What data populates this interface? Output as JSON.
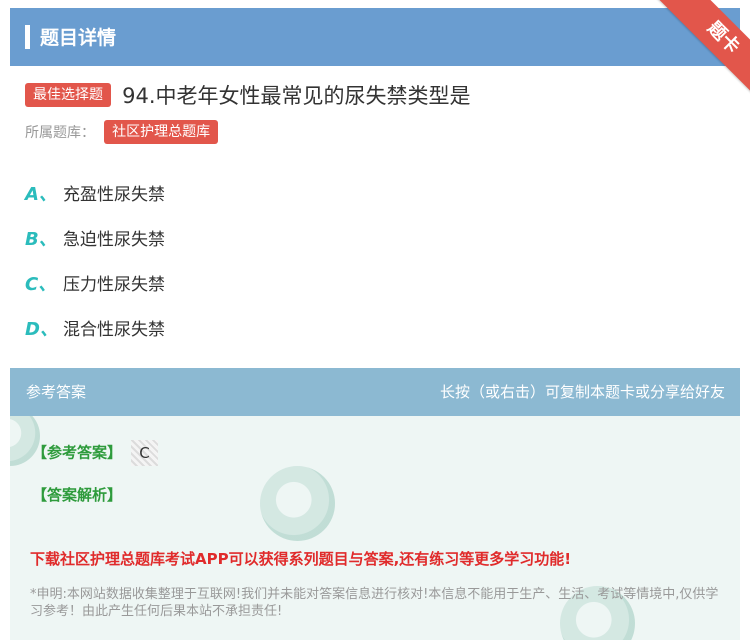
{
  "header": {
    "title": "题目详情",
    "ribbon": "题卡"
  },
  "question": {
    "type_tag": "最佳选择题",
    "text": "94.中老年女性最常见的尿失禁类型是",
    "bank_label": "所属题库：",
    "bank_name": "社区护理总题库"
  },
  "options": [
    {
      "letter": "A、",
      "text": "充盈性尿失禁"
    },
    {
      "letter": "B、",
      "text": "急迫性尿失禁"
    },
    {
      "letter": "C、",
      "text": "压力性尿失禁"
    },
    {
      "letter": "D、",
      "text": "混合性尿失禁"
    }
  ],
  "answer_section": {
    "title": "参考答案",
    "hint": "长按（或右击）可复制本题卡或分享给好友",
    "answer_label": "【参考答案】",
    "answer_value": "C",
    "analysis_label": "【答案解析】",
    "promo": "下载社区护理总题库考试APP可以获得系列题目与答案,还有练习等更多学习功能!",
    "disclaimer": "*申明:本网站数据收集整理于互联网!我们并未能对答案信息进行核对!本信息不能用于生产、生活、考试等情境中,仅供学习参考！由此产生任何后果本站不承担责任!"
  },
  "colors": {
    "header": "#6a9dd0",
    "ribbon": "#e2564b",
    "accent_teal": "#2bbcbc",
    "answer_green": "#2e9b3c",
    "promo_red": "#e02b2b"
  }
}
